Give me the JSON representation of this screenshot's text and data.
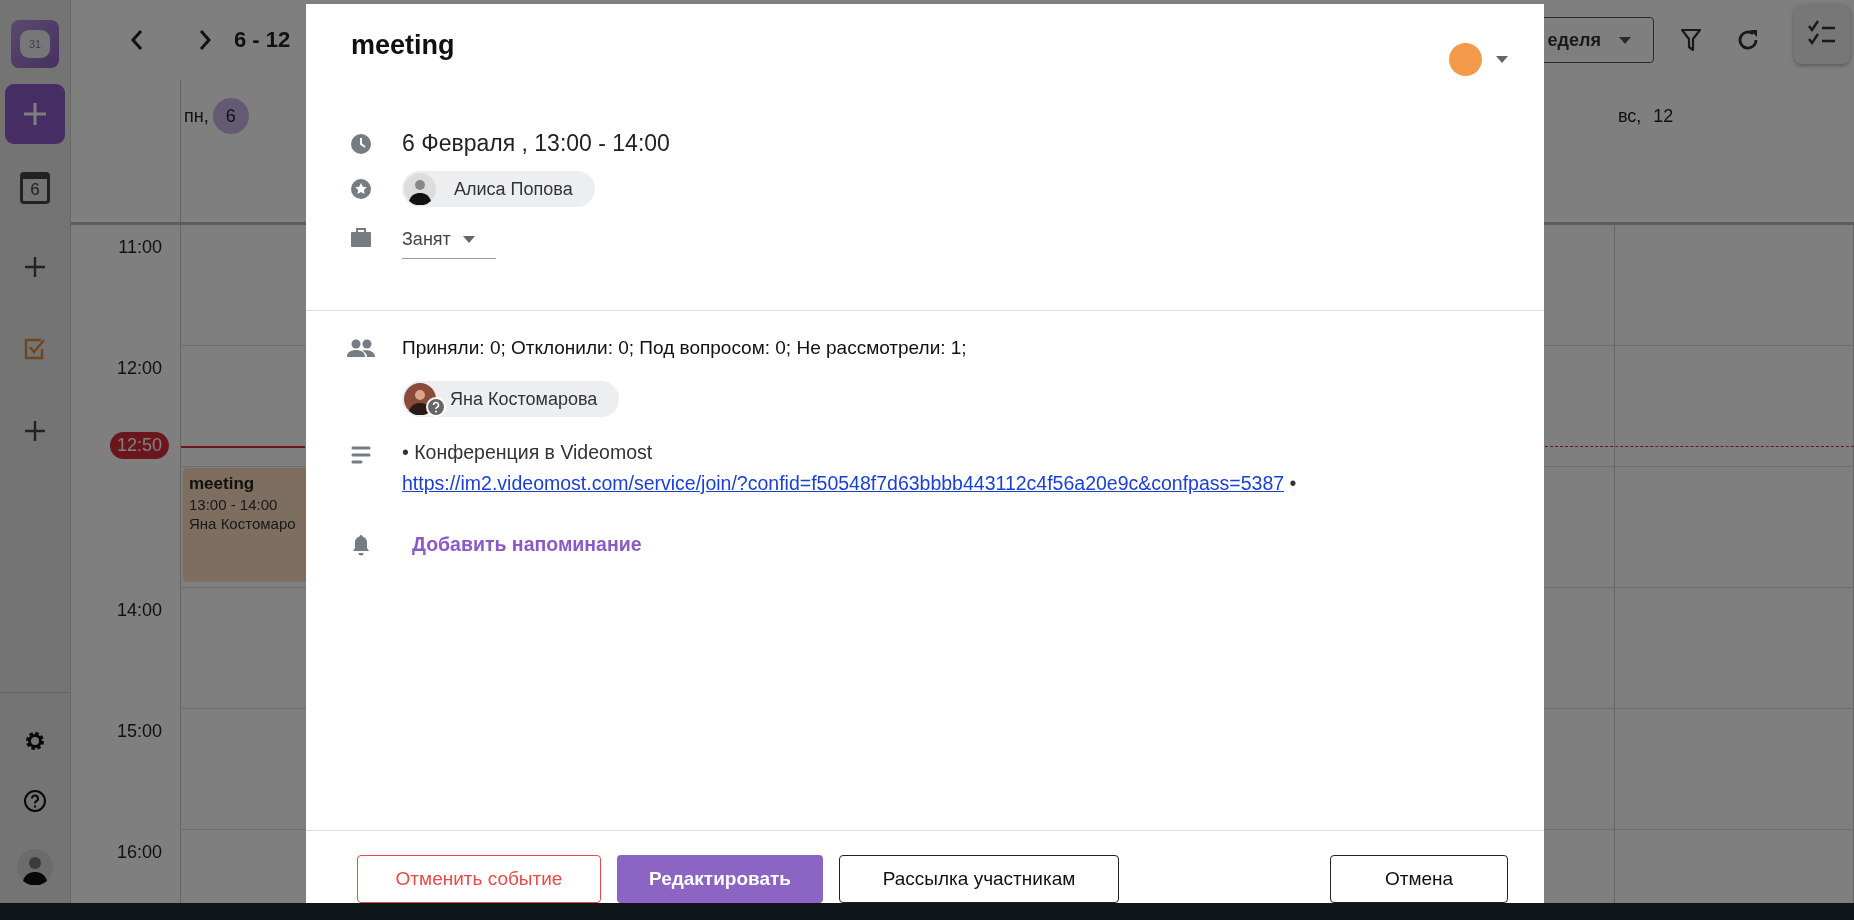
{
  "sidebar": {
    "logo_text": "31",
    "calendar_day": "6"
  },
  "toolbar": {
    "range": "6 - 12",
    "view_select": "еделя"
  },
  "days": [
    {
      "weekday": "пн,",
      "date": "6",
      "selected": true
    },
    {
      "weekday": "вс,",
      "date": "12",
      "selected": false
    }
  ],
  "hours": [
    "11:00",
    "12:00",
    "14:00",
    "15:00",
    "16:00"
  ],
  "now_label": "12:50",
  "event": {
    "title": "meeting",
    "time": "13:00 - 14:00",
    "attendee": "Яна Костомаро"
  },
  "dialog": {
    "title": "meeting",
    "date": "6 Февраля , 13:00 - 14:00",
    "organizer": "Алиса Попова",
    "availability": "Занят",
    "attendance_summary": "Приняли: 0; Отклонили: 0; Под вопросом: 0; Не рассмотрели: 1;",
    "attendees": [
      {
        "name": "Яна Костомарова",
        "pending": true
      }
    ],
    "description": "• Конференция в Videomost",
    "link": "https://im2.videomost.com/service/join/?confid=f50548f7d63bbbb443112c4f56a20e9c&confpass=5387",
    "link_suffix": "•",
    "reminder_action": "Добавить напоминание",
    "buttons": [
      {
        "label": "Отменить событие",
        "kind": "danger"
      },
      {
        "label": "Редактировать",
        "kind": "primary"
      },
      {
        "label": "Рассылка участникам",
        "kind": "outline"
      },
      {
        "label": "Отмена",
        "kind": "outline"
      }
    ]
  }
}
